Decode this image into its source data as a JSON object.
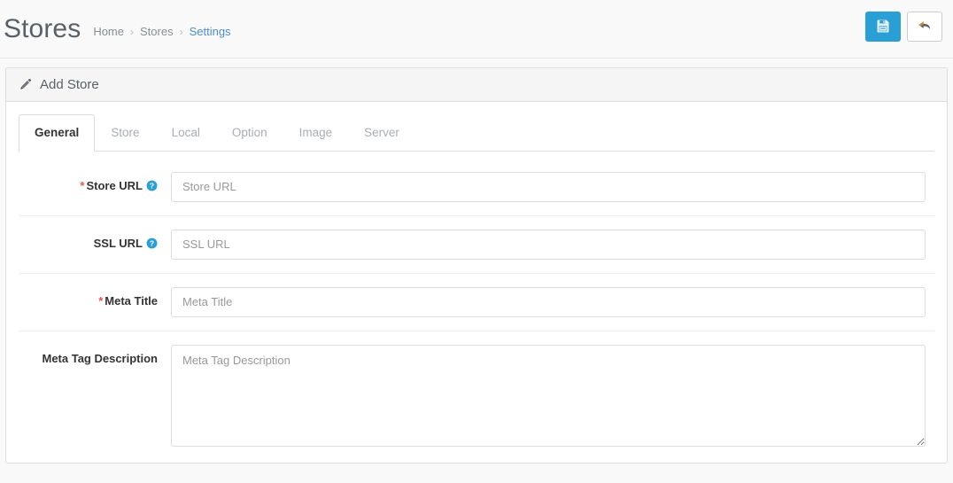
{
  "header": {
    "title": "Stores",
    "breadcrumb": [
      {
        "label": "Home",
        "active": false
      },
      {
        "label": "Stores",
        "active": false
      },
      {
        "label": "Settings",
        "active": true
      }
    ],
    "separator": "›",
    "actions": {
      "save": {
        "label": "Save",
        "icon": "floppy-disk-icon"
      },
      "back": {
        "label": "Back",
        "icon": "reply-arrow-icon"
      }
    },
    "colors": {
      "primary": "#2a9fd6",
      "link": "#4a90c4",
      "required": "#e8554d"
    }
  },
  "panel": {
    "heading": {
      "icon": "pencil-icon",
      "title": "Add Store"
    },
    "tabs": [
      {
        "label": "General",
        "active": true
      },
      {
        "label": "Store",
        "active": false
      },
      {
        "label": "Local",
        "active": false
      },
      {
        "label": "Option",
        "active": false
      },
      {
        "label": "Image",
        "active": false
      },
      {
        "label": "Server",
        "active": false
      }
    ],
    "form": {
      "fields": [
        {
          "label": "Store URL",
          "required": true,
          "help": true,
          "placeholder": "Store URL",
          "value": "",
          "type": "text"
        },
        {
          "label": "SSL URL",
          "required": false,
          "help": true,
          "placeholder": "SSL URL",
          "value": "",
          "type": "text"
        },
        {
          "label": "Meta Title",
          "required": true,
          "help": false,
          "placeholder": "Meta Title",
          "value": "",
          "type": "text"
        },
        {
          "label": "Meta Tag Description",
          "required": false,
          "help": false,
          "placeholder": "Meta Tag Description",
          "value": "",
          "type": "textarea"
        }
      ]
    }
  }
}
